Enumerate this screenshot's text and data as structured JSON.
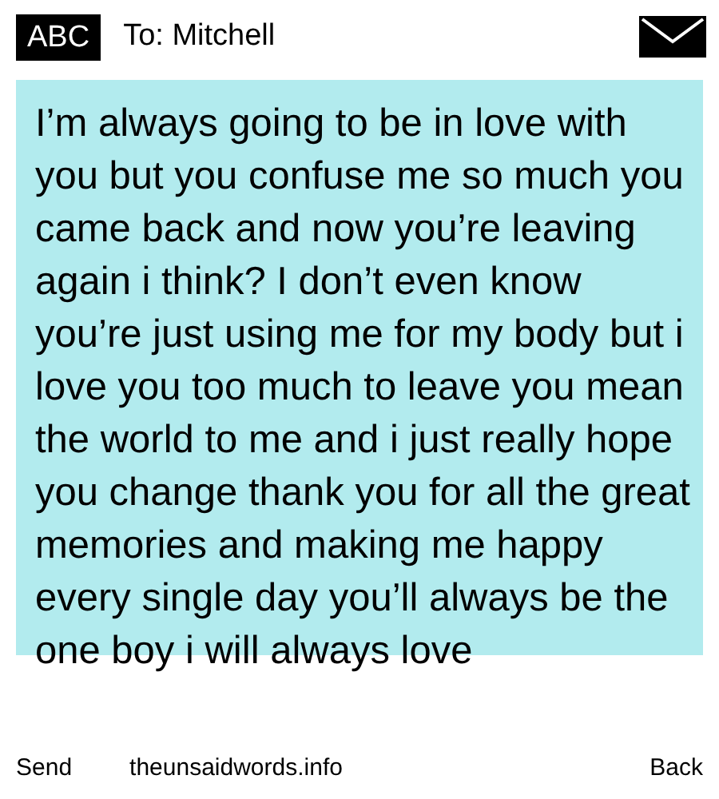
{
  "header": {
    "badge": "ABC",
    "recipient": "To: Mitchell"
  },
  "message": "I’m always going to be in love with you but you confuse me so much you came back and now you’re leaving again i think? I don’t even know you’re just using me for my body but i love you too much to leave you mean the world to me and i just really hope you change thank you for all the great memories and making me happy every single day you’ll always be the one boy i will always love",
  "footer": {
    "send": "Send",
    "site": "theunsaidwords.info",
    "back": "Back"
  }
}
